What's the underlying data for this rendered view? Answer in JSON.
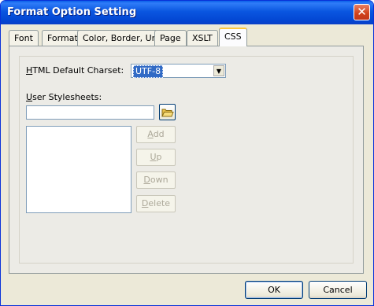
{
  "window": {
    "title": "Format Option Setting"
  },
  "tabs": [
    {
      "label": "Font"
    },
    {
      "label": "Format"
    },
    {
      "label": "Color, Border, Unit"
    },
    {
      "label": "Page"
    },
    {
      "label": "XSLT"
    },
    {
      "label": "CSS",
      "active": true
    }
  ],
  "css_tab": {
    "charset_label_underlined": "H",
    "charset_label_rest": "TML Default Charset:",
    "charset_value": "UTF-8",
    "stylesheets_label_underlined": "U",
    "stylesheets_label_rest": "ser Stylesheets:",
    "stylesheet_input_value": "",
    "buttons": {
      "add_u": "A",
      "add_rest": "dd",
      "up_u": "U",
      "up_rest": "p",
      "down_u": "D",
      "down_rest": "own",
      "delete_u": "D",
      "delete_rest": "elete"
    }
  },
  "footer": {
    "ok": "OK",
    "cancel": "Cancel"
  },
  "colors": {
    "titlebar": "#0a56e0",
    "dialog_bg": "#ece9d8",
    "selection": "#316ac5"
  }
}
